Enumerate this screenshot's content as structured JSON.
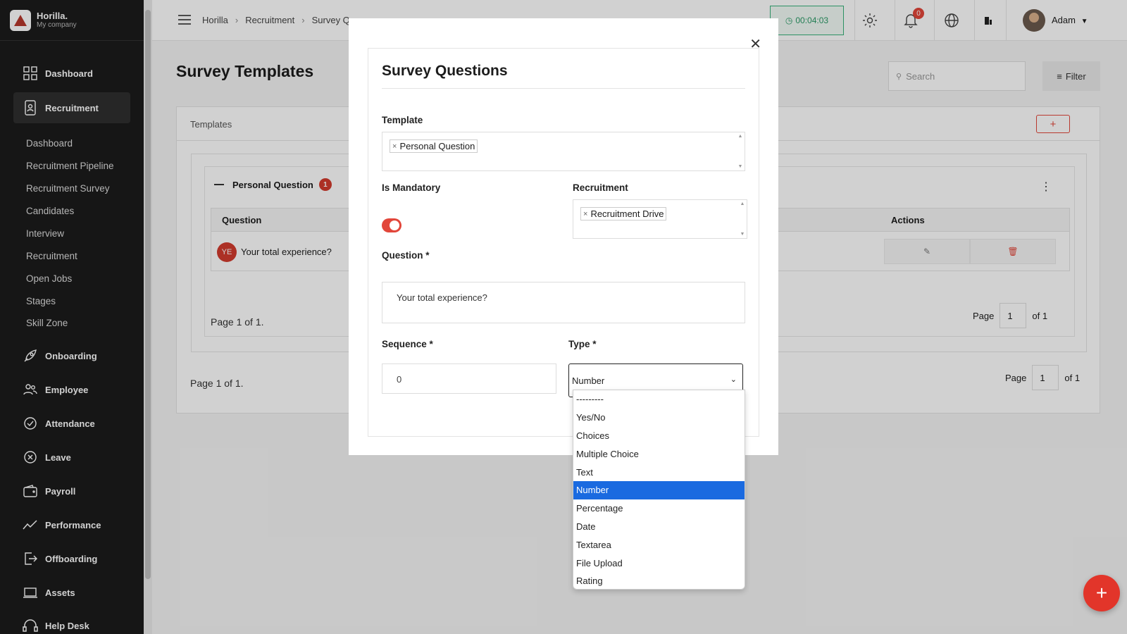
{
  "brand": {
    "name": "Horilla.",
    "company": "My company"
  },
  "sidebar": {
    "main": [
      {
        "label": "Dashboard",
        "icon": "grid-icon"
      },
      {
        "label": "Recruitment",
        "icon": "recruitment-icon"
      },
      {
        "label": "Onboarding",
        "icon": "rocket-icon"
      },
      {
        "label": "Employee",
        "icon": "people-icon"
      },
      {
        "label": "Attendance",
        "icon": "check-circle-icon"
      },
      {
        "label": "Leave",
        "icon": "x-circle-icon"
      },
      {
        "label": "Payroll",
        "icon": "wallet-icon"
      },
      {
        "label": "Performance",
        "icon": "chart-line-icon"
      },
      {
        "label": "Offboarding",
        "icon": "exit-icon"
      },
      {
        "label": "Assets",
        "icon": "laptop-icon"
      },
      {
        "label": "Help Desk",
        "icon": "headset-icon"
      }
    ],
    "sub": [
      "Dashboard",
      "Recruitment Pipeline",
      "Recruitment Survey",
      "Candidates",
      "Interview",
      "Recruitment",
      "Open Jobs",
      "Stages",
      "Skill Zone"
    ]
  },
  "topbar": {
    "crumbs": [
      "Horilla",
      "Recruitment",
      "Survey Q"
    ],
    "timer": "00:04:03",
    "notif_count": "0",
    "user": "Adam"
  },
  "page": {
    "title": "Survey Templates",
    "search_placeholder": "Search",
    "filter_label": "Filter",
    "card_label": "Templates",
    "add_label": "+",
    "group": {
      "name": "Personal Question",
      "count": "1"
    },
    "table": {
      "headers": [
        "Question",
        "Actions"
      ],
      "rows": [
        {
          "initials": "YE",
          "question": "Your total experience?"
        }
      ]
    },
    "inner_page_text": "Page 1 of 1.",
    "outer_page_text": "Page 1 of 1.",
    "pager": {
      "page_label": "Page",
      "page_value": "1",
      "of_label": "of 1"
    }
  },
  "modal": {
    "title": "Survey Questions",
    "template_label": "Template",
    "template_value": "Personal Question",
    "mandatory_label": "Is Mandatory",
    "mandatory_on": true,
    "recruitment_label": "Recruitment",
    "recruitment_value": "Recruitment Drive",
    "question_label": "Question",
    "question_value": "Your total experience?",
    "sequence_label": "Sequence",
    "sequence_value": "0",
    "type_label": "Type",
    "type_value": "Number",
    "required_mark": "*",
    "type_options": [
      "---------",
      "Yes/No",
      "Choices",
      "Multiple Choice",
      "Text",
      "Number",
      "Percentage",
      "Date",
      "Textarea",
      "File Upload",
      "Rating"
    ]
  },
  "colors": {
    "accent": "#e2463a",
    "sidebar_bg": "#1c1c1c",
    "selected_option": "#1a6ae0",
    "timer": "#2a9a66"
  }
}
